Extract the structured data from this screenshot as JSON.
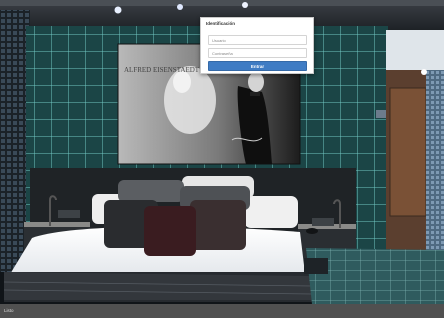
{
  "login": {
    "title": "Identificación",
    "username_placeholder": "Usuario",
    "password_placeholder": "Contraseña",
    "submit_label": "Entrar"
  },
  "status_bar": {
    "text": "Listo"
  },
  "colors": {
    "accent": "#3f7cc4",
    "wall_tile": "#1f4f50",
    "grout": "#6fd4d0",
    "status_bar": "#505050"
  }
}
